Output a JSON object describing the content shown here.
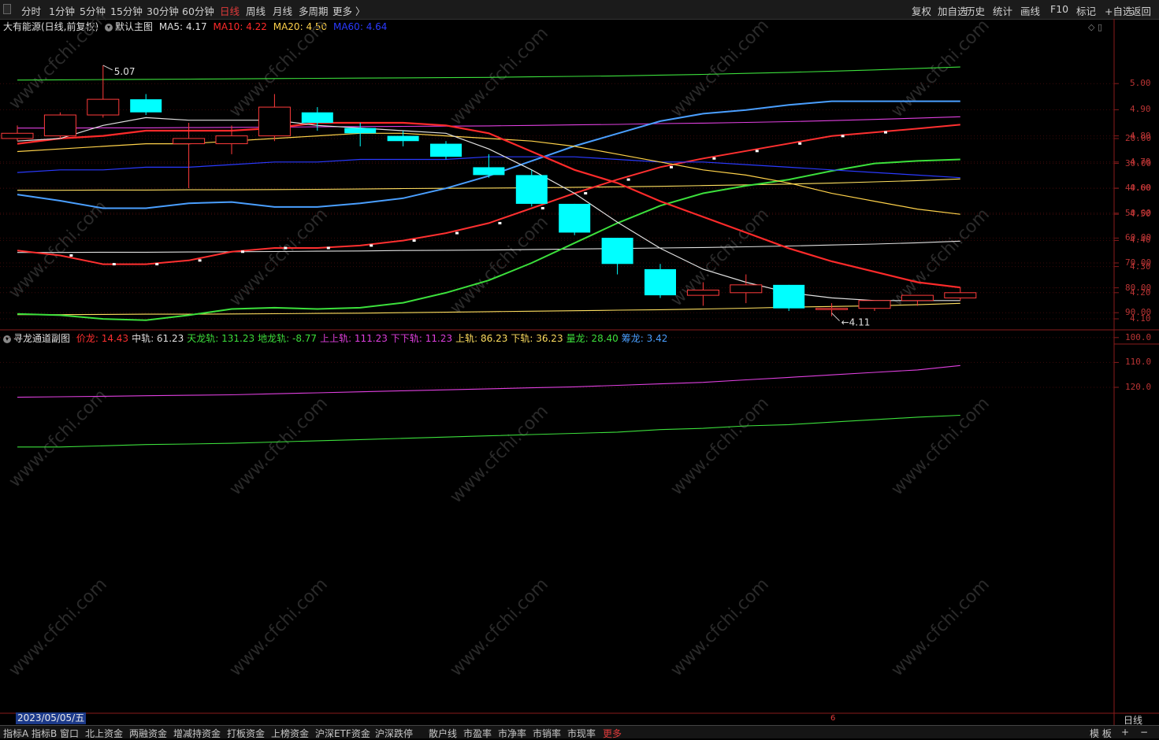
{
  "toolbar": {
    "periods": [
      "分时",
      "1分钟",
      "5分钟",
      "15分钟",
      "30分钟",
      "60分钟",
      "日线",
      "周线",
      "月线",
      "多周期",
      "更多 〉"
    ],
    "active_period": "日线",
    "right_buttons": [
      "复权",
      "加自选",
      "历史",
      "统计",
      "画线",
      "F10",
      "标记",
      "+自选",
      "返回"
    ]
  },
  "main_chart": {
    "stock_name": "大有能源(日线,前复权)",
    "template": "默认主图",
    "ma5": {
      "label": "MA5:",
      "value": "4.17",
      "color": "#e0e0e0"
    },
    "ma10": {
      "label": "MA10:",
      "value": "4.22",
      "color": "#ff2a2a"
    },
    "ma20": {
      "label": "MA20:",
      "value": "4.50",
      "color": "#ffd24a"
    },
    "ma60": {
      "label": "MA60:",
      "value": "4.64",
      "color": "#2a3aff"
    },
    "high_marker": "5.07",
    "low_marker": "4.11",
    "price_axis": [
      "5.00",
      "4.90",
      "4.80",
      "4.70",
      "4.60",
      "4.50",
      "4.40",
      "4.30",
      "4.20",
      "4.10"
    ],
    "candles": [
      {
        "o": 4.79,
        "c": 4.81,
        "h": 4.84,
        "l": 4.78
      },
      {
        "o": 4.8,
        "c": 4.88,
        "h": 4.89,
        "l": 4.79
      },
      {
        "o": 4.88,
        "c": 4.94,
        "h": 5.07,
        "l": 4.87
      },
      {
        "o": 4.94,
        "c": 4.89,
        "h": 4.96,
        "l": 4.88
      },
      {
        "o": 4.77,
        "c": 4.79,
        "h": 4.85,
        "l": 4.6
      },
      {
        "o": 4.77,
        "c": 4.8,
        "h": 4.84,
        "l": 4.73
      },
      {
        "o": 4.8,
        "c": 4.91,
        "h": 4.96,
        "l": 4.78
      },
      {
        "o": 4.89,
        "c": 4.85,
        "h": 4.91,
        "l": 4.82
      },
      {
        "o": 4.83,
        "c": 4.81,
        "h": 4.85,
        "l": 4.76
      },
      {
        "o": 4.8,
        "c": 4.78,
        "h": 4.82,
        "l": 4.76
      },
      {
        "o": 4.77,
        "c": 4.72,
        "h": 4.78,
        "l": 4.71
      },
      {
        "o": 4.68,
        "c": 4.65,
        "h": 4.73,
        "l": 4.64
      },
      {
        "o": 4.65,
        "c": 4.54,
        "h": 4.67,
        "l": 4.53
      },
      {
        "o": 4.54,
        "c": 4.43,
        "h": 4.54,
        "l": 4.42
      },
      {
        "o": 4.41,
        "c": 4.31,
        "h": 4.41,
        "l": 4.27
      },
      {
        "o": 4.29,
        "c": 4.19,
        "h": 4.31,
        "l": 4.18
      },
      {
        "o": 4.19,
        "c": 4.21,
        "h": 4.24,
        "l": 4.15
      },
      {
        "o": 4.2,
        "c": 4.23,
        "h": 4.27,
        "l": 4.16
      },
      {
        "o": 4.23,
        "c": 4.14,
        "h": 4.23,
        "l": 4.13
      },
      {
        "o": 4.14,
        "c": 4.14,
        "h": 4.16,
        "l": 4.11
      },
      {
        "o": 4.14,
        "c": 4.17,
        "h": 4.17,
        "l": 4.13
      },
      {
        "o": 4.17,
        "c": 4.19,
        "h": 4.19,
        "l": 4.15
      },
      {
        "o": 4.18,
        "c": 4.2,
        "h": 4.22,
        "l": 4.17
      }
    ],
    "ma5_line": [
      4.78,
      4.79,
      4.84,
      4.87,
      4.86,
      4.86,
      4.86,
      4.84,
      4.83,
      4.82,
      4.81,
      4.75,
      4.67,
      4.58,
      4.47,
      4.37,
      4.29,
      4.24,
      4.2,
      4.18,
      4.17,
      4.17,
      4.17
    ],
    "ma10_line": [
      4.77,
      4.79,
      4.8,
      4.82,
      4.82,
      4.82,
      4.83,
      4.85,
      4.85,
      4.85,
      4.84,
      4.81,
      4.74,
      4.67,
      4.62,
      4.55,
      4.49,
      4.43,
      4.37,
      4.32,
      4.28,
      4.24,
      4.22
    ],
    "ma20_line": [
      4.74,
      4.75,
      4.76,
      4.77,
      4.77,
      4.78,
      4.79,
      4.8,
      4.81,
      4.81,
      4.8,
      4.79,
      4.78,
      4.76,
      4.73,
      4.7,
      4.67,
      4.65,
      4.62,
      4.58,
      4.55,
      4.52,
      4.5
    ],
    "ma60_line": [
      4.66,
      4.67,
      4.67,
      4.68,
      4.68,
      4.69,
      4.7,
      4.7,
      4.71,
      4.71,
      4.71,
      4.72,
      4.72,
      4.72,
      4.71,
      4.7,
      4.7,
      4.69,
      4.68,
      4.67,
      4.66,
      4.65,
      4.64
    ]
  },
  "sub_chart": {
    "name": "寻龙通道副图",
    "indicators": [
      {
        "label": "价龙:",
        "value": "14.43",
        "color": "#ff3030"
      },
      {
        "label": "中轨:",
        "value": "61.23",
        "color": "#e0e0e0"
      },
      {
        "label": "天龙轨:",
        "value": "131.23",
        "color": "#3ce03c"
      },
      {
        "label": "地龙轨:",
        "value": "-8.77",
        "color": "#3ce03c"
      },
      {
        "label": "上上轨:",
        "value": "111.23",
        "color": "#e040e0"
      },
      {
        "label": "下下轨:",
        "value": "11.23",
        "color": "#e040e0"
      },
      {
        "label": "上轨:",
        "value": "86.23",
        "color": "#ffe060"
      },
      {
        "label": "下轨:",
        "value": "36.23",
        "color": "#ffe060"
      },
      {
        "label": "量龙:",
        "value": "28.40",
        "color": "#3ce03c"
      },
      {
        "label": "筹龙:",
        "value": "3.42",
        "color": "#4a9fff"
      }
    ],
    "value_axis": [
      "120.0",
      "110.0",
      "100.0",
      "90.00",
      "80.00",
      "70.00",
      "60.00",
      "50.00",
      "40.00",
      "30.00",
      "20.00"
    ],
    "price_dragon": [
      65,
      67,
      70.5,
      70.5,
      69,
      65.5,
      64,
      64,
      63,
      61,
      58,
      54,
      48,
      42,
      36.5,
      31.5,
      28,
      25,
      22,
      19,
      17.5,
      16,
      14.43
    ],
    "volume_dragon": [
      90.5,
      91,
      92.5,
      93,
      91,
      88.5,
      88,
      88.5,
      88,
      86,
      82,
      77,
      70,
      62,
      54,
      47,
      42,
      39,
      36.5,
      33,
      30,
      29,
      28.4
    ],
    "chip_dragon": [
      42.5,
      45,
      48,
      48,
      46,
      45.5,
      47.5,
      47.5,
      46,
      44,
      40,
      35,
      29,
      23,
      18,
      13,
      10,
      8.5,
      6.5,
      5,
      5,
      5,
      5
    ],
    "tianlong": [
      144,
      144,
      143.5,
      143,
      142.8,
      142.5,
      142,
      141.5,
      141,
      140.5,
      140,
      139.5,
      139,
      138.5,
      138,
      137,
      136.5,
      135.5,
      135,
      134,
      133,
      132,
      131.23
    ],
    "shangshang": [
      124,
      123.8,
      123.6,
      123.4,
      123.2,
      123,
      122.6,
      122.2,
      121.8,
      121.4,
      121,
      120.6,
      120.2,
      119.8,
      119.2,
      118.6,
      118,
      117,
      116,
      115,
      114,
      113,
      111.23
    ],
    "shang": [
      90.8,
      90.8,
      90.7,
      90.6,
      90.6,
      90.5,
      90.4,
      90.3,
      90.2,
      90,
      89.8,
      89.6,
      89.4,
      89.2,
      89,
      88.8,
      88.5,
      88.2,
      87.8,
      87.5,
      87.2,
      86.8,
      86.23
    ],
    "zhong": [
      65.8,
      65.8,
      65.7,
      65.7,
      65.6,
      65.5,
      65.4,
      65.3,
      65.2,
      65,
      64.9,
      64.8,
      64.6,
      64.4,
      64.2,
      64,
      63.8,
      63.5,
      63.2,
      62.8,
      62.4,
      61.9,
      61.23
    ],
    "xia": [
      40.8,
      40.8,
      40.7,
      40.7,
      40.6,
      40.6,
      40.5,
      40.4,
      40.3,
      40.1,
      40,
      39.9,
      39.8,
      39.6,
      39.4,
      39.2,
      38.9,
      38.6,
      38.3,
      37.9,
      37.4,
      36.9,
      36.23
    ],
    "xiaxia": [
      15.8,
      15.8,
      15.7,
      15.7,
      15.6,
      15.5,
      15.4,
      15.3,
      15.2,
      15.1,
      15,
      14.9,
      14.7,
      14.5,
      14.3,
      14,
      13.8,
      13.5,
      13.2,
      12.8,
      12.3,
      11.8,
      11.23
    ],
    "dilong": [
      -3.5,
      -3.6,
      -3.7,
      -3.8,
      -3.9,
      -4,
      -4.1,
      -4.2,
      -4.3,
      -4.4,
      -4.5,
      -4.6,
      -4.8,
      -5,
      -5.2,
      -5.5,
      -5.8,
      -6.2,
      -6.6,
      -7.1,
      -7.6,
      -8.2,
      -8.77
    ]
  },
  "bottom": {
    "date": "2023/05/05/五",
    "month_mark": "6",
    "period": "日线",
    "tabs": [
      "指标A",
      "指标B",
      "窗口",
      "北上资金",
      "两融资金",
      "增减持资金",
      "打板资金",
      "上榜资金",
      "沪深ETF资金",
      "沪深跌停",
      "散户线",
      "市盈率",
      "市净率",
      "市销率",
      "市现率",
      "更多"
    ],
    "right_tabs": [
      "模 板",
      "+",
      "−"
    ]
  }
}
